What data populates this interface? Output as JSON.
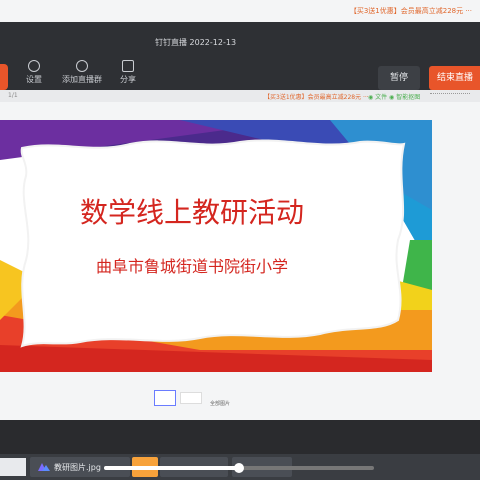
{
  "top_banner": {
    "promo_text": "【买3送1优惠】会员最高立减228元 ···"
  },
  "live_window": {
    "title": "钉钉直播 2022-12-13",
    "tools": [
      {
        "label": "设置",
        "icon": "gear-icon"
      },
      {
        "label": "添加直播群",
        "icon": "add-group-icon"
      },
      {
        "label": "分享",
        "icon": "share-icon"
      }
    ],
    "pause_label": "暂停",
    "end_label": "结束直播"
  },
  "viewer": {
    "page_indicator": "1/1",
    "promo_text": "【买3送1优惠】会员最高立减228元 ···",
    "green_text": "◉ 文件 ◉ 智能抠图",
    "all_images_label": "全部图片"
  },
  "slide": {
    "title": "数学线上教研活动",
    "subtitle": "曲阜市鲁城街道书院街小学",
    "colors": {
      "title": "#d4261f",
      "subtitle": "#d4261f"
    }
  },
  "taskbar": {
    "file_name": "教研图片.jpg",
    "progress": 0.5
  }
}
